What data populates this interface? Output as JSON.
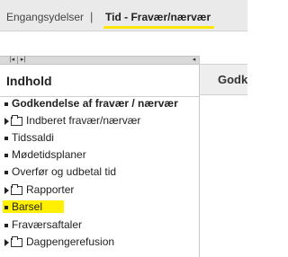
{
  "nav": {
    "tab1": "Engangsydelser",
    "separator": "|",
    "tab2": "Tid - Fravær/nærvær"
  },
  "pane": {
    "title": "Indhold",
    "items": [
      {
        "label": "Godkendelse af fravær / nærvær",
        "type": "link",
        "bold": true
      },
      {
        "label": "Indberet fravær/nærvær",
        "type": "folder"
      },
      {
        "label": "Tidssaldi",
        "type": "link"
      },
      {
        "label": "Mødetidsplaner",
        "type": "link"
      },
      {
        "label": "Overfør og udbetal tid",
        "type": "link"
      },
      {
        "label": "Rapporter",
        "type": "folder"
      },
      {
        "label": "Barsel",
        "type": "link",
        "highlighted": true
      },
      {
        "label": "Fraværsaftaler",
        "type": "link"
      },
      {
        "label": "Dagpengerefusion",
        "type": "folder"
      }
    ]
  },
  "right": {
    "heading": "Godk"
  },
  "colors": {
    "highlight": "#ffef00",
    "nav_underline": "#ffe600"
  }
}
